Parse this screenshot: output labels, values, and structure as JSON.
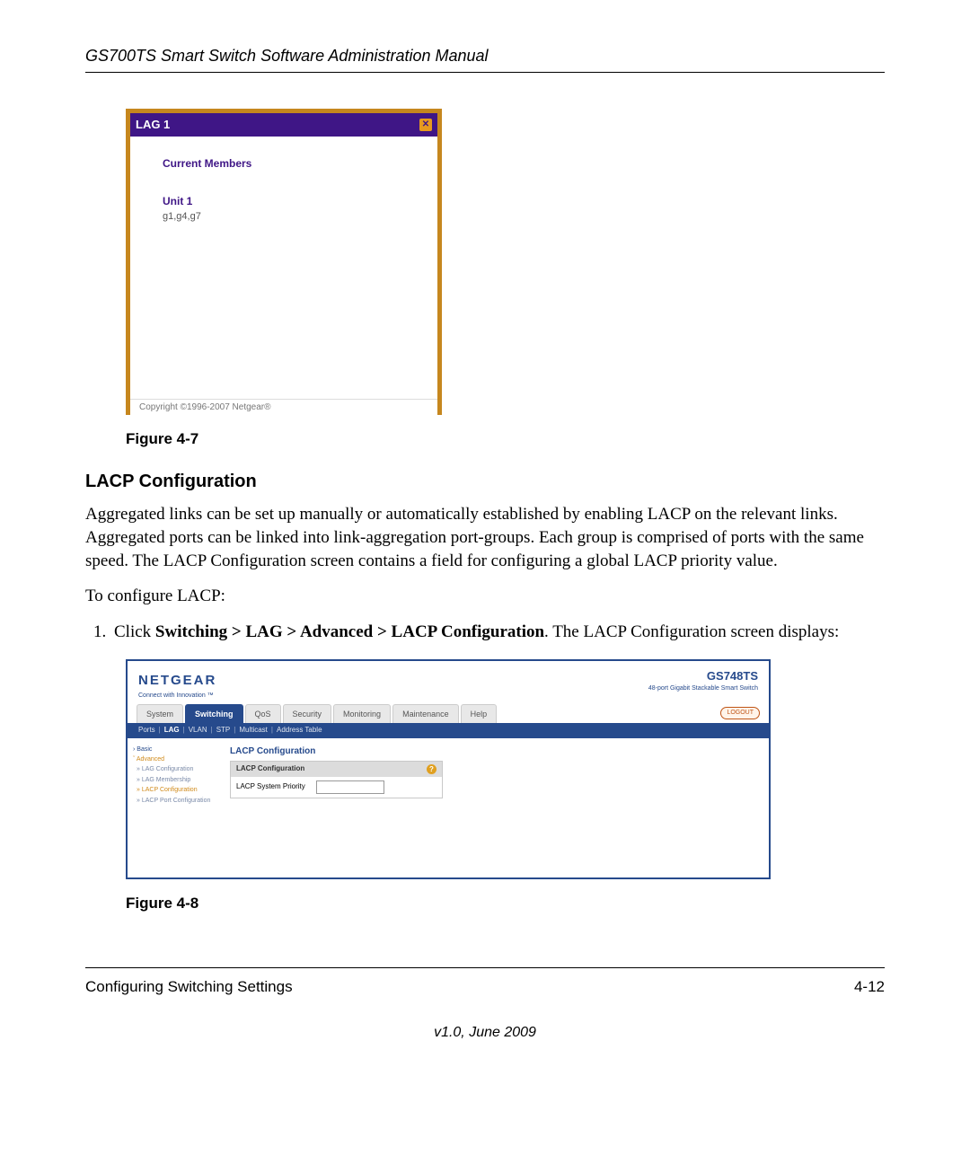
{
  "header": "GS700TS Smart Switch Software Administration Manual",
  "fig47": {
    "title": "LAG 1",
    "current_members": "Current Members",
    "unit": "Unit 1",
    "ports": "g1,g4,g7",
    "copyright": "Copyright ©1996-2007 Netgear®"
  },
  "caption47": "Figure 4-7",
  "section_title": "LACP Configuration",
  "para1": "Aggregated links can be set up manually or automatically established by enabling LACP on the relevant links. Aggregated ports can be linked into link-aggregation port-groups. Each group is comprised of ports with the same speed. The LACP Configuration screen contains a field for configuring a global LACP priority value.",
  "para2": "To configure LACP:",
  "step1_a": "Click ",
  "step1_b": "Switching > LAG > Advanced > LACP Configuration",
  "step1_c": ". The LACP Configuration screen displays:",
  "fig48": {
    "brand": "NETGEAR",
    "brand_sub": "Connect with Innovation ™",
    "model": "GS748TS",
    "model_sub": "48-port Gigabit Stackable Smart Switch",
    "tabs": [
      "System",
      "Switching",
      "QoS",
      "Security",
      "Monitoring",
      "Maintenance",
      "Help"
    ],
    "active_tab": "Switching",
    "logout": "LOGOUT",
    "subtabs": [
      "Ports",
      "LAG",
      "VLAN",
      "STP",
      "Multicast",
      "Address Table"
    ],
    "active_subtab": "LAG",
    "side_basic": "Basic",
    "side_advanced": "Advanced",
    "side_items": [
      "LAG Configuration",
      "LAG Membership",
      "LACP Configuration",
      "LACP Port Configuration"
    ],
    "side_current": "LACP Configuration",
    "content_title": "LACP Configuration",
    "panel_title": "LACP Configuration",
    "field_label": "LACP System Priority",
    "field_value": ""
  },
  "caption48": "Figure 4-8",
  "footer_left": "Configuring Switching Settings",
  "footer_right": "4-12",
  "footer_version": "v1.0, June 2009"
}
